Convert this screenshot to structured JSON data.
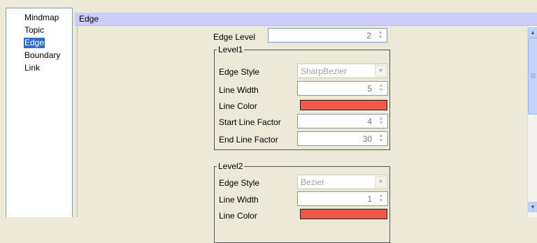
{
  "sidebar": {
    "items": [
      {
        "label": "Mindmap"
      },
      {
        "label": "Topic"
      },
      {
        "label": "Edge"
      },
      {
        "label": "Boundary"
      },
      {
        "label": "Link"
      }
    ],
    "selected": "Edge"
  },
  "header": {
    "title": "Edge"
  },
  "edge_level": {
    "label": "Edge Level",
    "value": "2"
  },
  "groups": [
    {
      "title": "Level1",
      "edge_style": {
        "label": "Edge Style",
        "value": "SharpBezier"
      },
      "line_width": {
        "label": "Line Width",
        "value": "5"
      },
      "line_color": {
        "label": "Line Color",
        "color": "#f0594a"
      },
      "start_line_factor": {
        "label": "Start Line Factor",
        "value": "4"
      },
      "end_line_factor": {
        "label": "End Line Factor",
        "value": "30"
      }
    },
    {
      "title": "Level2",
      "edge_style": {
        "label": "Edge Style",
        "value": "Bezier"
      },
      "line_width": {
        "label": "Line Width",
        "value": "1"
      },
      "line_color": {
        "label": "Line Color",
        "color": "#f0594a"
      }
    }
  ],
  "icons": {
    "spin_up": "▲",
    "spin_down": "▼",
    "dropdown": "▼",
    "scroll_up": "▲",
    "scroll_down": "▼"
  }
}
